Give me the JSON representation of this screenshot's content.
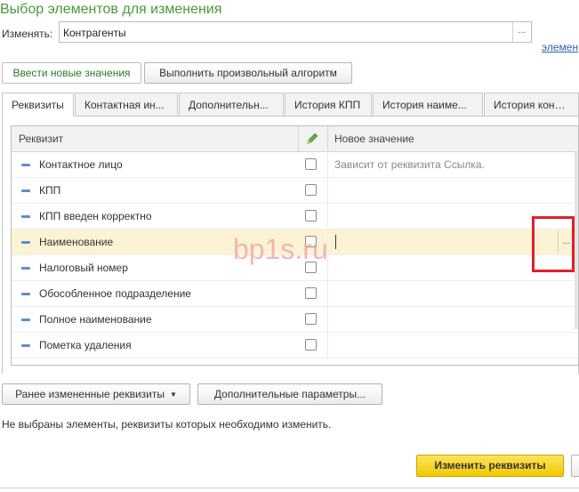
{
  "window": {
    "title": "Выбор элементов для изменения"
  },
  "change_field": {
    "label": "Изменять:",
    "value": "Контрагенты",
    "dots": "..."
  },
  "side_link": "элемен",
  "mode_buttons": [
    {
      "label": "Ввести новые значения",
      "active": true
    },
    {
      "label": "Выполнить произвольный алгоритм",
      "active": false
    }
  ],
  "tabs": [
    {
      "label": "Реквизиты",
      "active": true
    },
    {
      "label": "Контактная ин..."
    },
    {
      "label": "Дополнительн..."
    },
    {
      "label": "История КПП"
    },
    {
      "label": "История наиме..."
    },
    {
      "label": "История контак..."
    }
  ],
  "grid": {
    "columns": {
      "attribute": "Реквизит",
      "new_value": "Новое значение"
    },
    "rows": [
      {
        "name": "Контактное лицо",
        "checked": false,
        "new_value": "Зависит от реквизита Ссылка."
      },
      {
        "name": "КПП",
        "checked": false,
        "new_value": ""
      },
      {
        "name": "КПП введен корректно",
        "checked": false,
        "new_value": ""
      },
      {
        "name": "Наименование",
        "checked": false,
        "new_value": "",
        "selected": true,
        "dots": "..."
      },
      {
        "name": "Налоговый номер",
        "checked": false,
        "new_value": ""
      },
      {
        "name": "Обособленное подразделение",
        "checked": false,
        "new_value": ""
      },
      {
        "name": "Полное наименование",
        "checked": false,
        "new_value": ""
      },
      {
        "name": "Пометка удаления",
        "checked": false,
        "new_value": ""
      }
    ]
  },
  "watermark": "bp1s.ru",
  "bottom_buttons": {
    "previous": "Ранее измененные реквизиты",
    "additional": "Дополнительные параметры..."
  },
  "status_text": "Не выбраны элементы, реквизиты которых необходимо изменить.",
  "primary_button": "Изменить реквизиты",
  "colors": {
    "title": "#4a9a3a",
    "primary": "#f2c800",
    "selected_row": "#fdf3d4",
    "highlight": "#e0202a"
  }
}
